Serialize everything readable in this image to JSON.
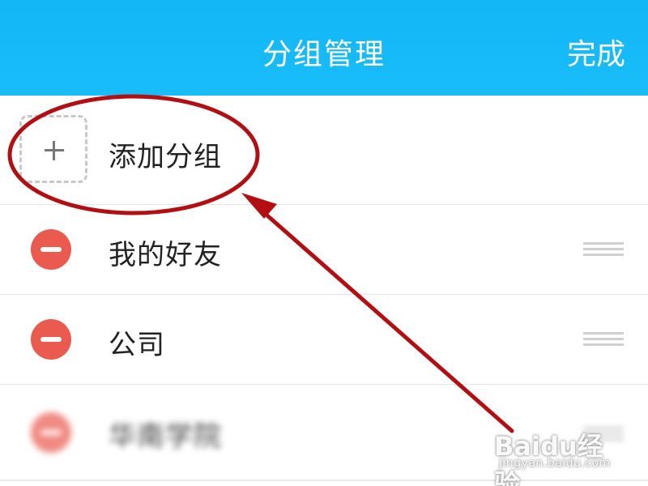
{
  "header": {
    "title": "分组管理",
    "done_label": "完成"
  },
  "add_group": {
    "label": "添加分组"
  },
  "groups": [
    {
      "label": "我的好友"
    },
    {
      "label": "公司"
    },
    {
      "label": "华南学院"
    }
  ],
  "watermark": {
    "logo": "Baidu经验",
    "url": "jingyan.baidu.com"
  },
  "colors": {
    "header_blue": "#18bdf8",
    "delete_red": "#ea5a4f",
    "annotation_red": "#b30f13"
  },
  "icons": {
    "add": "plus-icon",
    "delete": "minus-circle-icon",
    "reorder": "drag-handle-icon"
  }
}
